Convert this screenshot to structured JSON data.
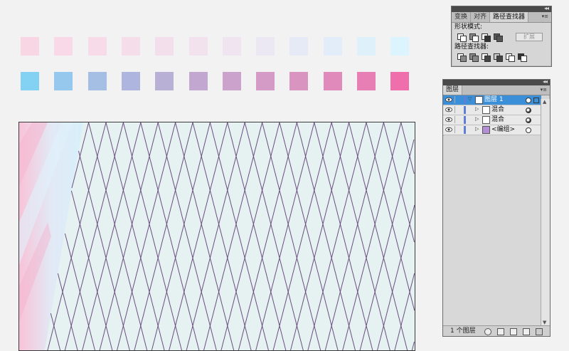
{
  "swatches": {
    "row1": [
      "#f9d6e4",
      "#f9d8e7",
      "#f8dbe9",
      "#f5ddea",
      "#f3dfeb",
      "#f2e2ee",
      "#efe4f0",
      "#ebe7f3",
      "#e6eaf6",
      "#e2edf9",
      "#def1fb",
      "#dbf4fd"
    ],
    "row2": [
      "#83d2f4",
      "#95c8ec",
      "#a4bee4",
      "#aeb5de",
      "#b9b0d6",
      "#c2a8d0",
      "#cba2cb",
      "#d39bc5",
      "#da94c0",
      "#e08abb",
      "#e77fb4",
      "#ef6fac"
    ]
  },
  "colors": {
    "artboard_bg": "#e6f1f1",
    "grid_line": "#6a4e80",
    "gradient_pink": "#f8bcd4",
    "gradient_blue": "#d6eefb",
    "selection": "#3b8fd8"
  },
  "pathfinder": {
    "tabs": [
      "变换",
      "对齐",
      "路径查找器"
    ],
    "active_tab": 2,
    "shape_modes_label": "形状模式:",
    "pathfinders_label": "路径查找器:",
    "expand_label": "扩展",
    "menu_icon": "panel-menu-icon",
    "collapse_icon": "collapse-arrows-icon"
  },
  "layers": {
    "title": "图层",
    "rows": [
      {
        "name": "图层 1",
        "expanded": true,
        "selected": true,
        "thumb": "layer-thumb"
      },
      {
        "name": "混合",
        "expanded": false,
        "selected": false,
        "thumb": "blend-thumb"
      },
      {
        "name": "混合",
        "expanded": false,
        "selected": false,
        "thumb": "blend-thumb"
      },
      {
        "name": "<编组>",
        "expanded": false,
        "selected": false,
        "thumb": "group-thumb"
      }
    ],
    "footer_text": "1 个图层"
  }
}
